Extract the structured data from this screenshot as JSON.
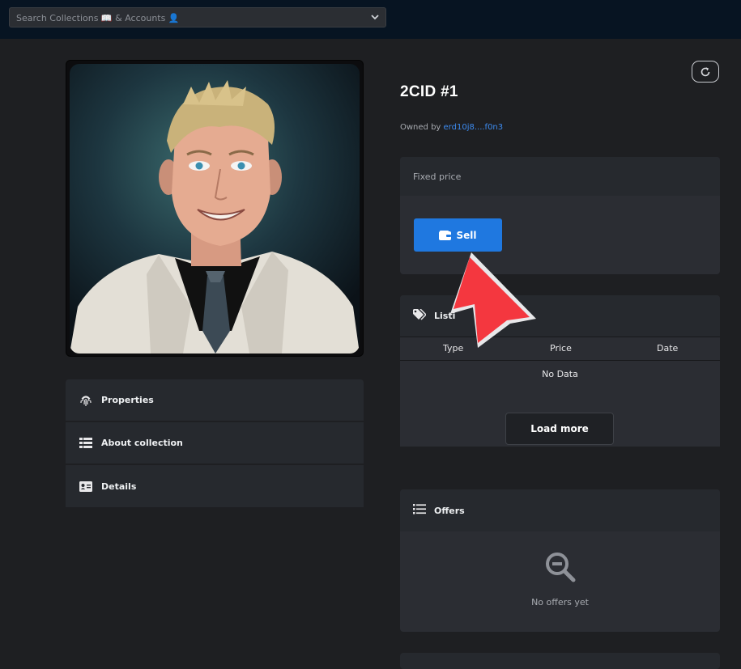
{
  "search": {
    "placeholder": "Search Collections 📖 & Accounts 👤"
  },
  "nft": {
    "title": "2CID #1",
    "owned_by_label": "Owned by",
    "owner": "erd10j8....f0n3"
  },
  "side_panels": [
    {
      "label": "Properties",
      "icon": "fingerprint-icon"
    },
    {
      "label": "About collection",
      "icon": "table-list-icon"
    },
    {
      "label": "Details",
      "icon": "id-card-icon"
    }
  ],
  "price_card": {
    "label": "Fixed price",
    "sell_label": "Sell"
  },
  "listings": {
    "title": "Listi",
    "columns": [
      "Type",
      "Price",
      "Date"
    ],
    "empty": "No Data",
    "load_more": "Load more"
  },
  "offers": {
    "title": "Offers",
    "empty": "No offers yet"
  },
  "colors": {
    "accent": "#1f78e0",
    "link": "#3d8bf0",
    "arrow": "#f4373f",
    "background": "#1e1f22",
    "topbar": "#071422"
  }
}
